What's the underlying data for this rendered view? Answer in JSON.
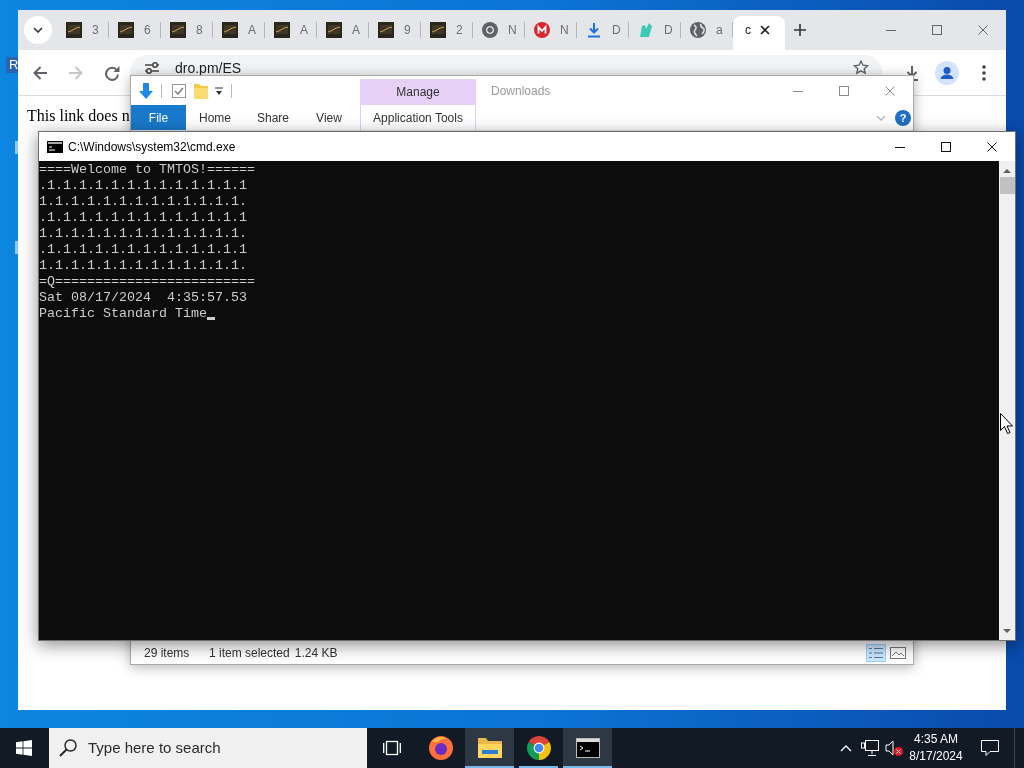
{
  "desktop": {
    "icon_label": "R"
  },
  "browser": {
    "tabs": [
      {
        "title": "3",
        "kind": "thumbnail",
        "selected": false
      },
      {
        "title": "6",
        "kind": "thumbnail",
        "selected": false
      },
      {
        "title": "8",
        "kind": "thumbnail",
        "selected": false
      },
      {
        "title": "A",
        "kind": "thumbnail",
        "selected": false
      },
      {
        "title": "A",
        "kind": "thumbnail",
        "selected": false
      },
      {
        "title": "A",
        "kind": "thumbnail",
        "selected": false
      },
      {
        "title": "9",
        "kind": "thumbnail",
        "selected": false
      },
      {
        "title": "2",
        "kind": "thumbnail",
        "selected": false
      },
      {
        "title": "N",
        "kind": "chrome",
        "selected": false
      },
      {
        "title": "N",
        "kind": "mega",
        "selected": false
      },
      {
        "title": "D",
        "kind": "download",
        "selected": false
      },
      {
        "title": "D",
        "kind": "teal",
        "selected": false
      },
      {
        "title": "a",
        "kind": "globe",
        "selected": false
      },
      {
        "title": "c",
        "kind": "plain",
        "selected": true
      }
    ],
    "nav_buttons": [
      {
        "kind": "back",
        "disabled": false
      },
      {
        "kind": "forward",
        "disabled": true
      },
      {
        "kind": "reload",
        "disabled": false
      }
    ],
    "address": "dro.pm/ES",
    "page_text": "This link does n"
  },
  "explorer": {
    "title": "Downloads",
    "context_header": "Manage",
    "ribbon_tabs": [
      {
        "label": "File",
        "kind": "file"
      },
      {
        "label": "Home",
        "kind": "tab"
      },
      {
        "label": "Share",
        "kind": "tab"
      },
      {
        "label": "View",
        "kind": "tab"
      },
      {
        "label": "Application Tools",
        "kind": "context"
      }
    ],
    "help_label": "?",
    "status": [
      "29 items",
      "1 item selected",
      "1.24 KB"
    ],
    "view_buttons": [
      {
        "kind": "details",
        "selected": true
      },
      {
        "kind": "large_icons",
        "selected": false
      }
    ]
  },
  "console": {
    "title": "C:\\Windows\\system32\\cmd.exe",
    "lines": [
      "====Welcome to TMTOS!======",
      ".1.1.1.1.1.1.1.1.1.1.1.1.1",
      "1.1.1.1.1.1.1.1.1.1.1.1.1.",
      ".1.1.1.1.1.1.1.1.1.1.1.1.1",
      "1.1.1.1.1.1.1.1.1.1.1.1.1.",
      ".1.1.1.1.1.1.1.1.1.1.1.1.1",
      "1.1.1.1.1.1.1.1.1.1.1.1.1.",
      "=Q=========================",
      "Sat 08/17/2024  4:35:57.53",
      "Pacific Standard Time"
    ],
    "cursor": true
  },
  "taskbar": {
    "search_placeholder": "Type here to search",
    "apps": [
      {
        "kind": "task_view",
        "running": false,
        "highlighted": false
      },
      {
        "kind": "firefox",
        "running": false,
        "highlighted": false
      },
      {
        "kind": "explorer",
        "running": true,
        "highlighted": true
      },
      {
        "kind": "chrome",
        "running": true,
        "highlighted": false
      },
      {
        "kind": "console",
        "running": true,
        "highlighted": true
      }
    ],
    "volume_muted": true,
    "time": "4:35 AM",
    "date": "8/17/2024"
  }
}
